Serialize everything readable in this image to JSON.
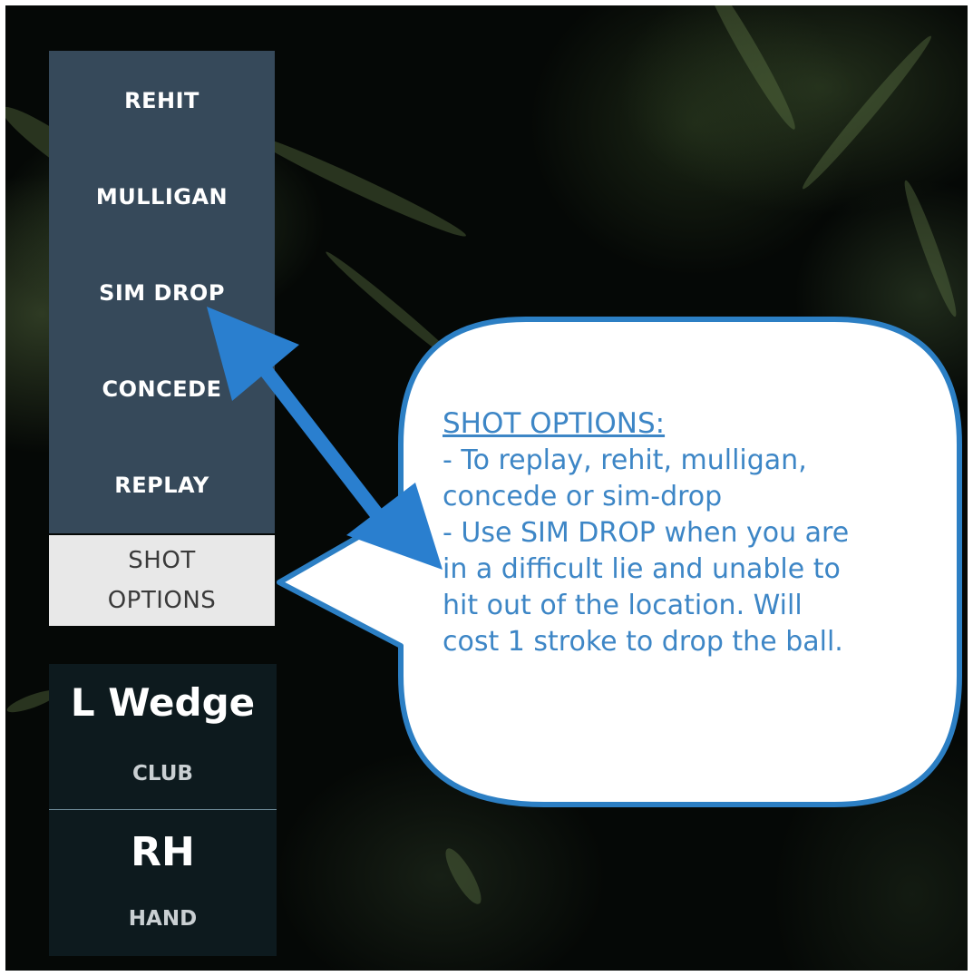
{
  "shot_menu": {
    "items": [
      {
        "label": "REHIT"
      },
      {
        "label": "MULLIGAN"
      },
      {
        "label": "SIM DROP"
      },
      {
        "label": "CONCEDE"
      },
      {
        "label": "REPLAY"
      }
    ],
    "tab_line1": "SHOT",
    "tab_line2": "OPTIONS"
  },
  "club": {
    "value": "L Wedge",
    "label": "CLUB"
  },
  "hand": {
    "value": "RH",
    "label": "HAND"
  },
  "callout": {
    "title": "SHOT OPTIONS:",
    "line1": "- To replay, rehit, mulligan,",
    "line2": "concede or sim-drop",
    "line3": "- Use SIM DROP when you are",
    "line4": "in a difficult lie and unable to",
    "line5": "hit out of the location.  Will",
    "line6": "cost 1 stroke to drop the ball."
  },
  "colors": {
    "menu_bg": "#36495a",
    "tab_bg": "#e8e8e8",
    "info_bg": "#0d1a1e",
    "callout_border": "#2c7fc4",
    "callout_text": "#3d86c6",
    "arrow": "#2a7fcf"
  }
}
